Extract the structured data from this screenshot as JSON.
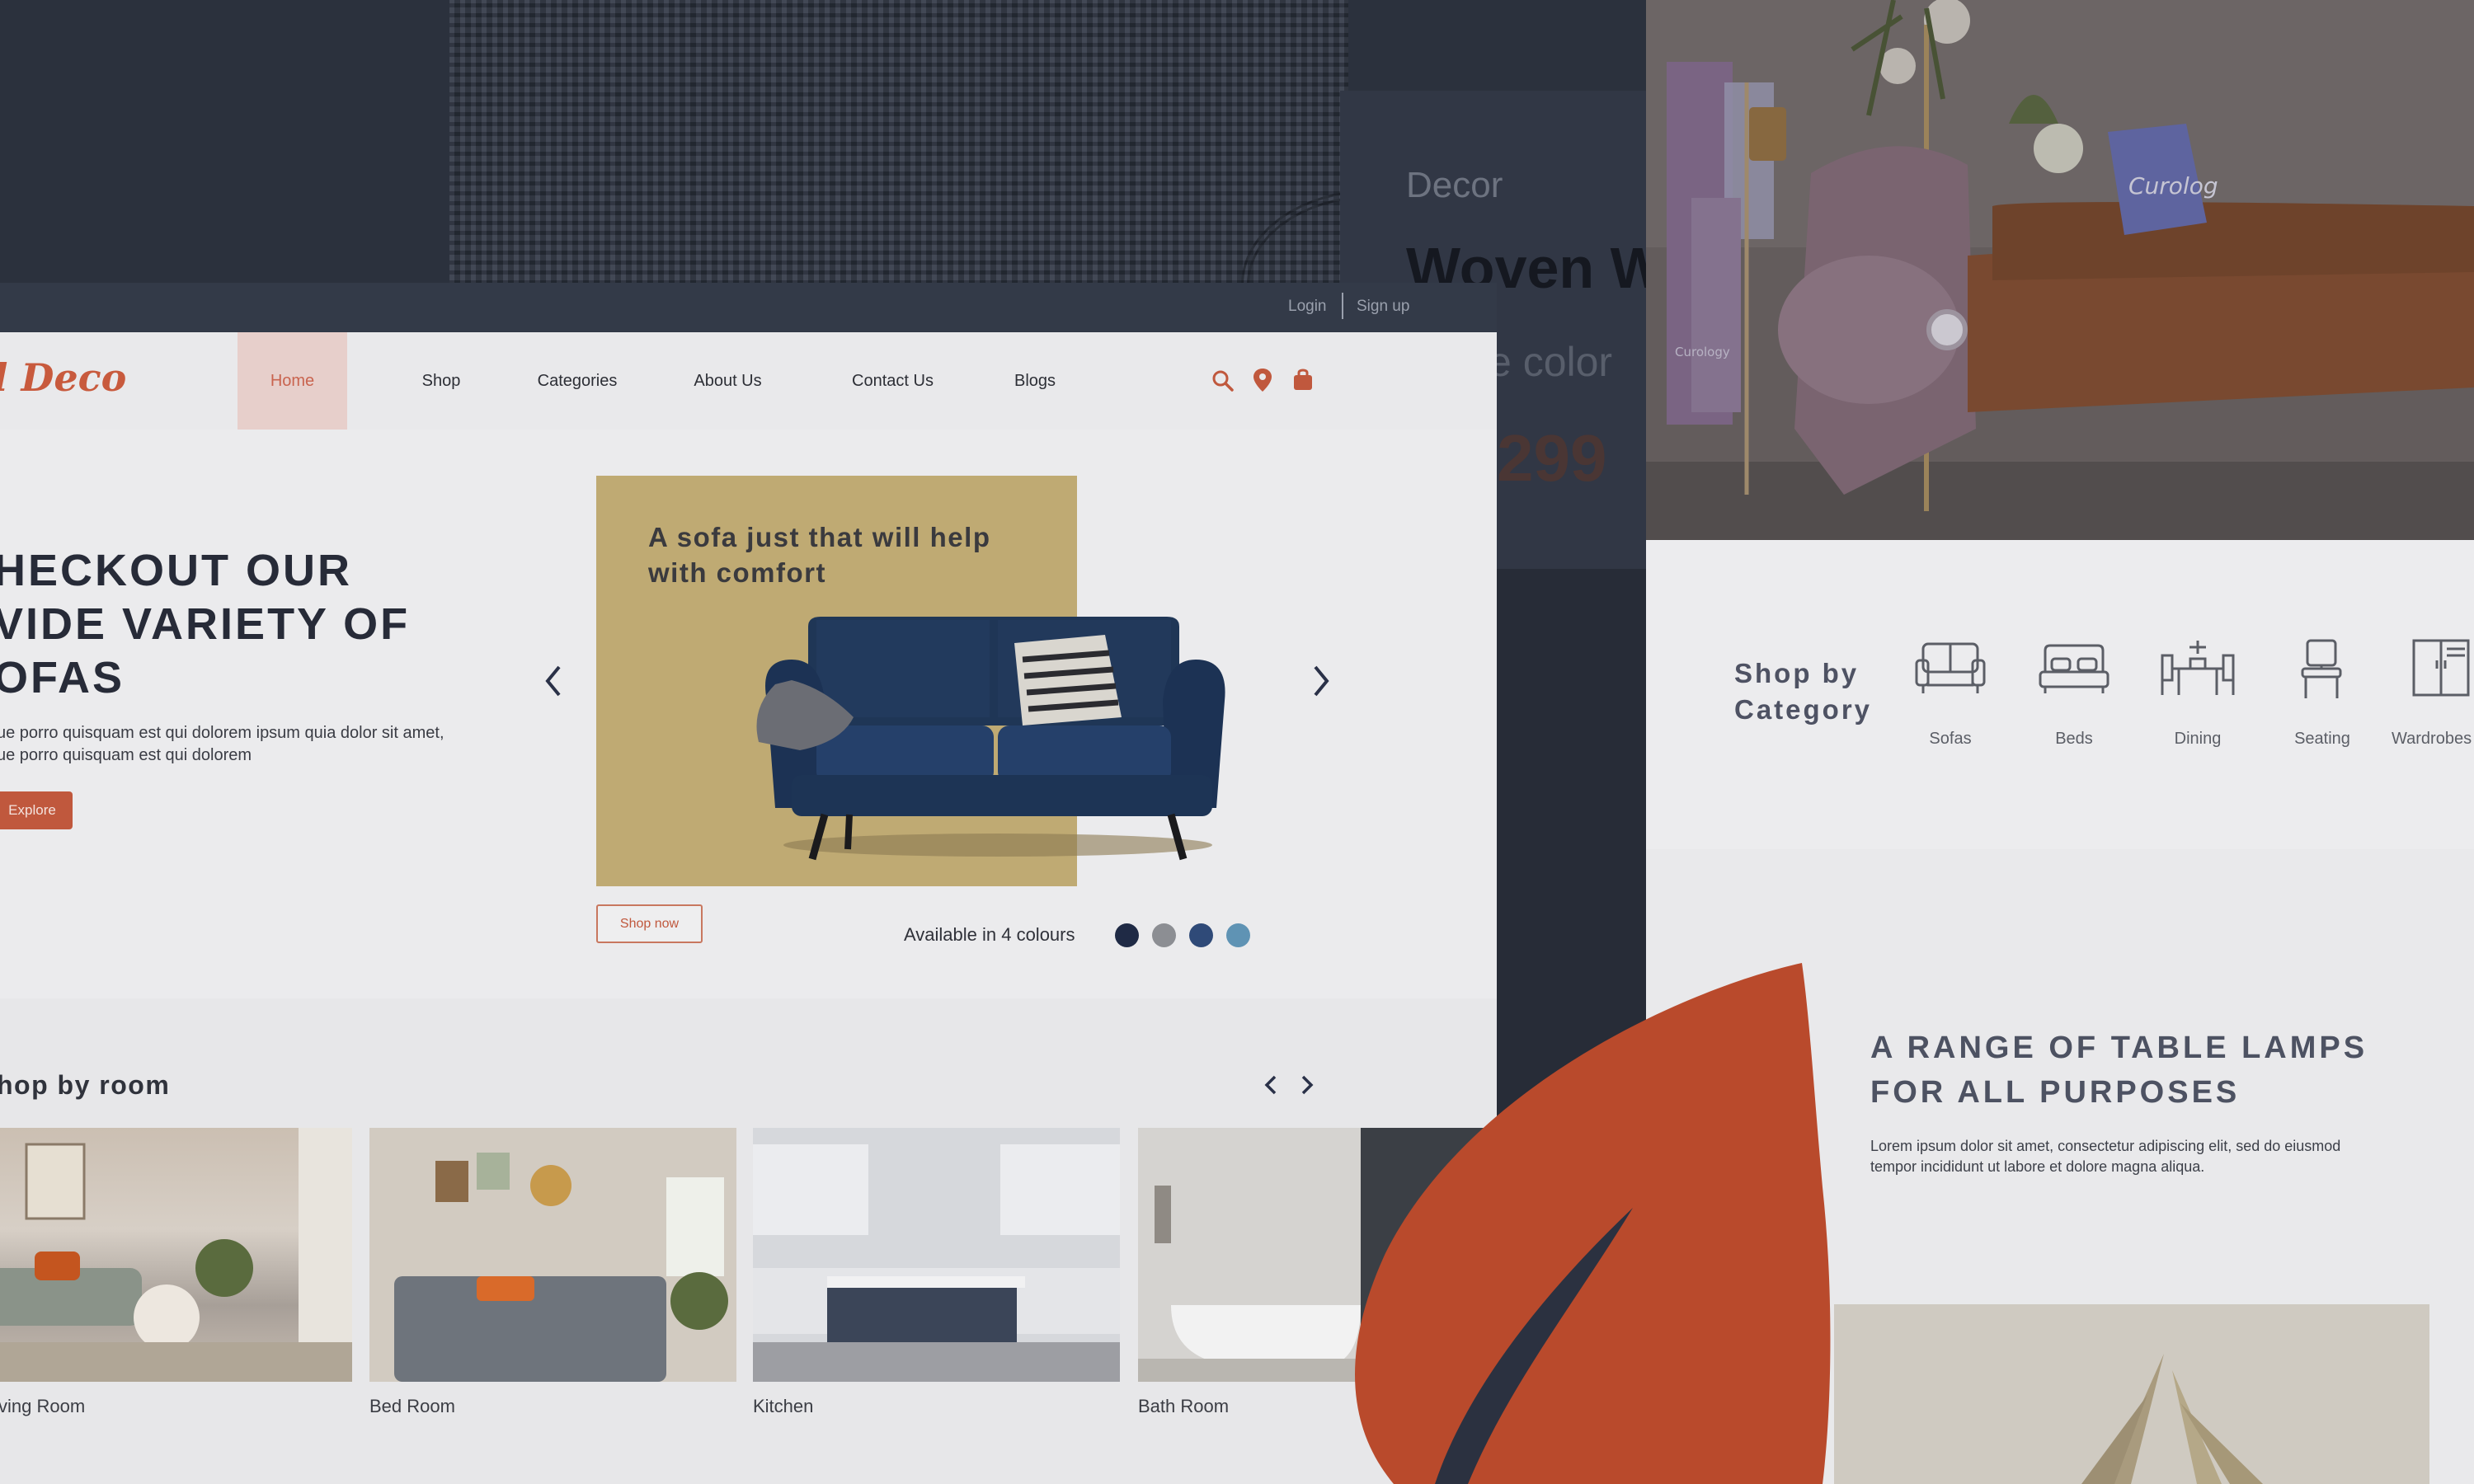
{
  "pdp": {
    "category": "Decor",
    "title": "Woven W",
    "color_label": "e color",
    "price": "299"
  },
  "topbar": {
    "login": "Login",
    "signup": "Sign up"
  },
  "brand": "l Deco",
  "nav": {
    "home": "Home",
    "shop": "Shop",
    "categories": "Categories",
    "about": "About Us",
    "contact": "Contact Us",
    "blogs": "Blogs"
  },
  "hero": {
    "line1": "HECKOUT OUR",
    "line2": "VIDE VARIETY OF",
    "line3": "OFAS",
    "body1": "ue porro quisquam est qui dolorem ipsum quia dolor sit amet,",
    "body2": "ue porro quisquam est qui dolorem",
    "explore": "Explore",
    "slide_caption": "A sofa just that will help with comfort",
    "shop_now": "Shop now",
    "available": "Available in 4 colours",
    "colours": [
      "#1f2a45",
      "#8c8e93",
      "#2f4a78",
      "#5f93b4"
    ]
  },
  "rooms": {
    "title": "hop by room",
    "items": [
      "ving Room",
      "Bed Room",
      "Kitchen",
      "Bath Room"
    ]
  },
  "category": {
    "title_line1": "Shop by",
    "title_line2": "Category",
    "items": [
      "Sofas",
      "Beds",
      "Dining",
      "Seating",
      "Wardrobes"
    ]
  },
  "lamps": {
    "title_line1": "A RANGE OF TABLE LAMPS",
    "title_line2": "FOR ALL PURPOSES",
    "body1": "Lorem ipsum dolor sit amet, consectetur adipiscing elit, sed do eiusmod",
    "body2": "tempor incididunt ut labore et dolore magna aliqua."
  },
  "pillow_text": "Curolog",
  "towel_text": "Curology",
  "colors": {
    "accent": "#c0583d",
    "leaf": "#b94a2c",
    "overlay_dark": "#2c3240"
  }
}
